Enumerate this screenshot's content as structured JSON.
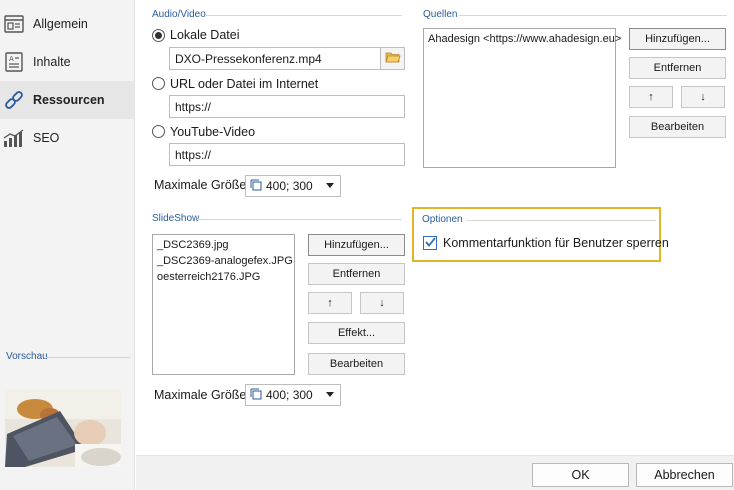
{
  "sidebar": {
    "items": [
      {
        "label": "Allgemein",
        "icon": "layout-icon"
      },
      {
        "label": "Inhalte",
        "icon": "document-icon"
      },
      {
        "label": "Ressourcen",
        "icon": "link-icon"
      },
      {
        "label": "SEO",
        "icon": "bar-chart-icon"
      }
    ],
    "active": "Ressourcen",
    "preview_label": "Vorschau"
  },
  "audio_video": {
    "title": "Audio/Video",
    "options": [
      {
        "label": "Lokale Datei",
        "value": "DXO-Pressekonferenz.mp4",
        "checked": true
      },
      {
        "label": "URL oder Datei im Internet",
        "value": "https://",
        "checked": false
      },
      {
        "label": "YouTube-Video",
        "value": "https://",
        "checked": false
      }
    ],
    "max_size_label": "Maximale Größe:",
    "max_size_value": "400; 300"
  },
  "quellen": {
    "title": "Quellen",
    "items": [
      "Ahadesign <https://www.ahadesign.eu>"
    ],
    "buttons": {
      "add": "Hinzufügen...",
      "remove": "Entfernen",
      "edit": "Bearbeiten",
      "up": "↑",
      "down": "↓"
    }
  },
  "slideshow": {
    "title": "SlideShow",
    "items": [
      "_DSC2369.jpg",
      "_DSC2369-analogefex.JPG",
      "oesterreich2176.JPG"
    ],
    "buttons": {
      "add": "Hinzufügen...",
      "remove": "Entfernen",
      "effect": "Effekt...",
      "edit": "Bearbeiten",
      "up": "↑",
      "down": "↓"
    },
    "max_size_label": "Maximale Größe:",
    "max_size_value": "400; 300"
  },
  "optionen": {
    "title": "Optionen",
    "checkbox_label": "Kommentarfunktion für Benutzer sperren",
    "checked": true
  },
  "footer": {
    "ok": "OK",
    "cancel": "Abbrechen"
  },
  "colors": {
    "accent": "#2a5b9c",
    "highlight": "#e2b42a",
    "checkbox": "#2f6db5"
  }
}
